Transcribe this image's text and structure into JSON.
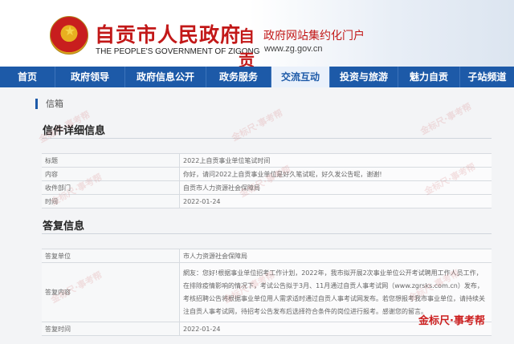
{
  "header": {
    "title": "自贡市人民政府",
    "subtitle": "THE PEOPLE'S GOVERNMENT OF ZIGONG",
    "portal_logo_text": "自贡",
    "portal_name": "政府网站集约化门户",
    "portal_url": "www.zg.gov.cn"
  },
  "nav": {
    "items": [
      {
        "label": "首页"
      },
      {
        "label": "政府领导"
      },
      {
        "label": "政府信息公开"
      },
      {
        "label": "政务服务"
      },
      {
        "label": "交流互动"
      },
      {
        "label": "投资与旅游"
      },
      {
        "label": "魅力自贡"
      },
      {
        "label": "子站频道"
      }
    ],
    "active_index": 4
  },
  "breadcrumb": {
    "label": "信箱"
  },
  "letter_section": {
    "title": "信件详细信息",
    "rows": [
      {
        "label": "标题",
        "value": "2022上自贡事业单位笔试时间"
      },
      {
        "label": "内容",
        "value": "你好，请问2022上自贡事业单位是好久笔试呢，好久发公告呢，谢谢!"
      },
      {
        "label": "收件部门",
        "value": "自贡市人力资源社会保障局"
      },
      {
        "label": "时间",
        "value": "2022-01-24"
      }
    ]
  },
  "reply_section": {
    "title": "答复信息",
    "unit_label": "答复单位",
    "unit_value": "市人力资源社会保障局",
    "content_label": "答复内容",
    "content_value": "網友：您好!根据事业单位招考工作计划，2022年，我市拟开展2次事业单位公开考试聘用工作人员工作，在排除疫情影响的情况下，考试公告拟于3月、11月通过自贡人事考试网（www.zgrsks.com.cn）发布，考核招聘公告将根据事业单位用人需求适时通过自贡人事考试网发布。若您想报考我市事业单位，请持续关注自贡人事考试网，待招考公告发布后选择符合条件的岗位进行报考。感谢您的留言。",
    "time_label": "答复时间",
    "time_value": "2022-01-24"
  },
  "watermarks": [
    "金标尺·事考帮",
    "金标尺·事考帮",
    "金标尺·事考帮",
    "金标尺·事考帮",
    "金标尺·事考帮",
    "金标尺·事考帮",
    "金标尺·事考帮",
    "金标尺·事考帮",
    "金标尺·事考帮"
  ],
  "brand_mark": "金标尺·事考帮",
  "colors": {
    "brand_red": "#c21818",
    "nav_blue": "#1d5aa8"
  },
  "icons": {
    "emblem": "national-emblem-icon"
  }
}
